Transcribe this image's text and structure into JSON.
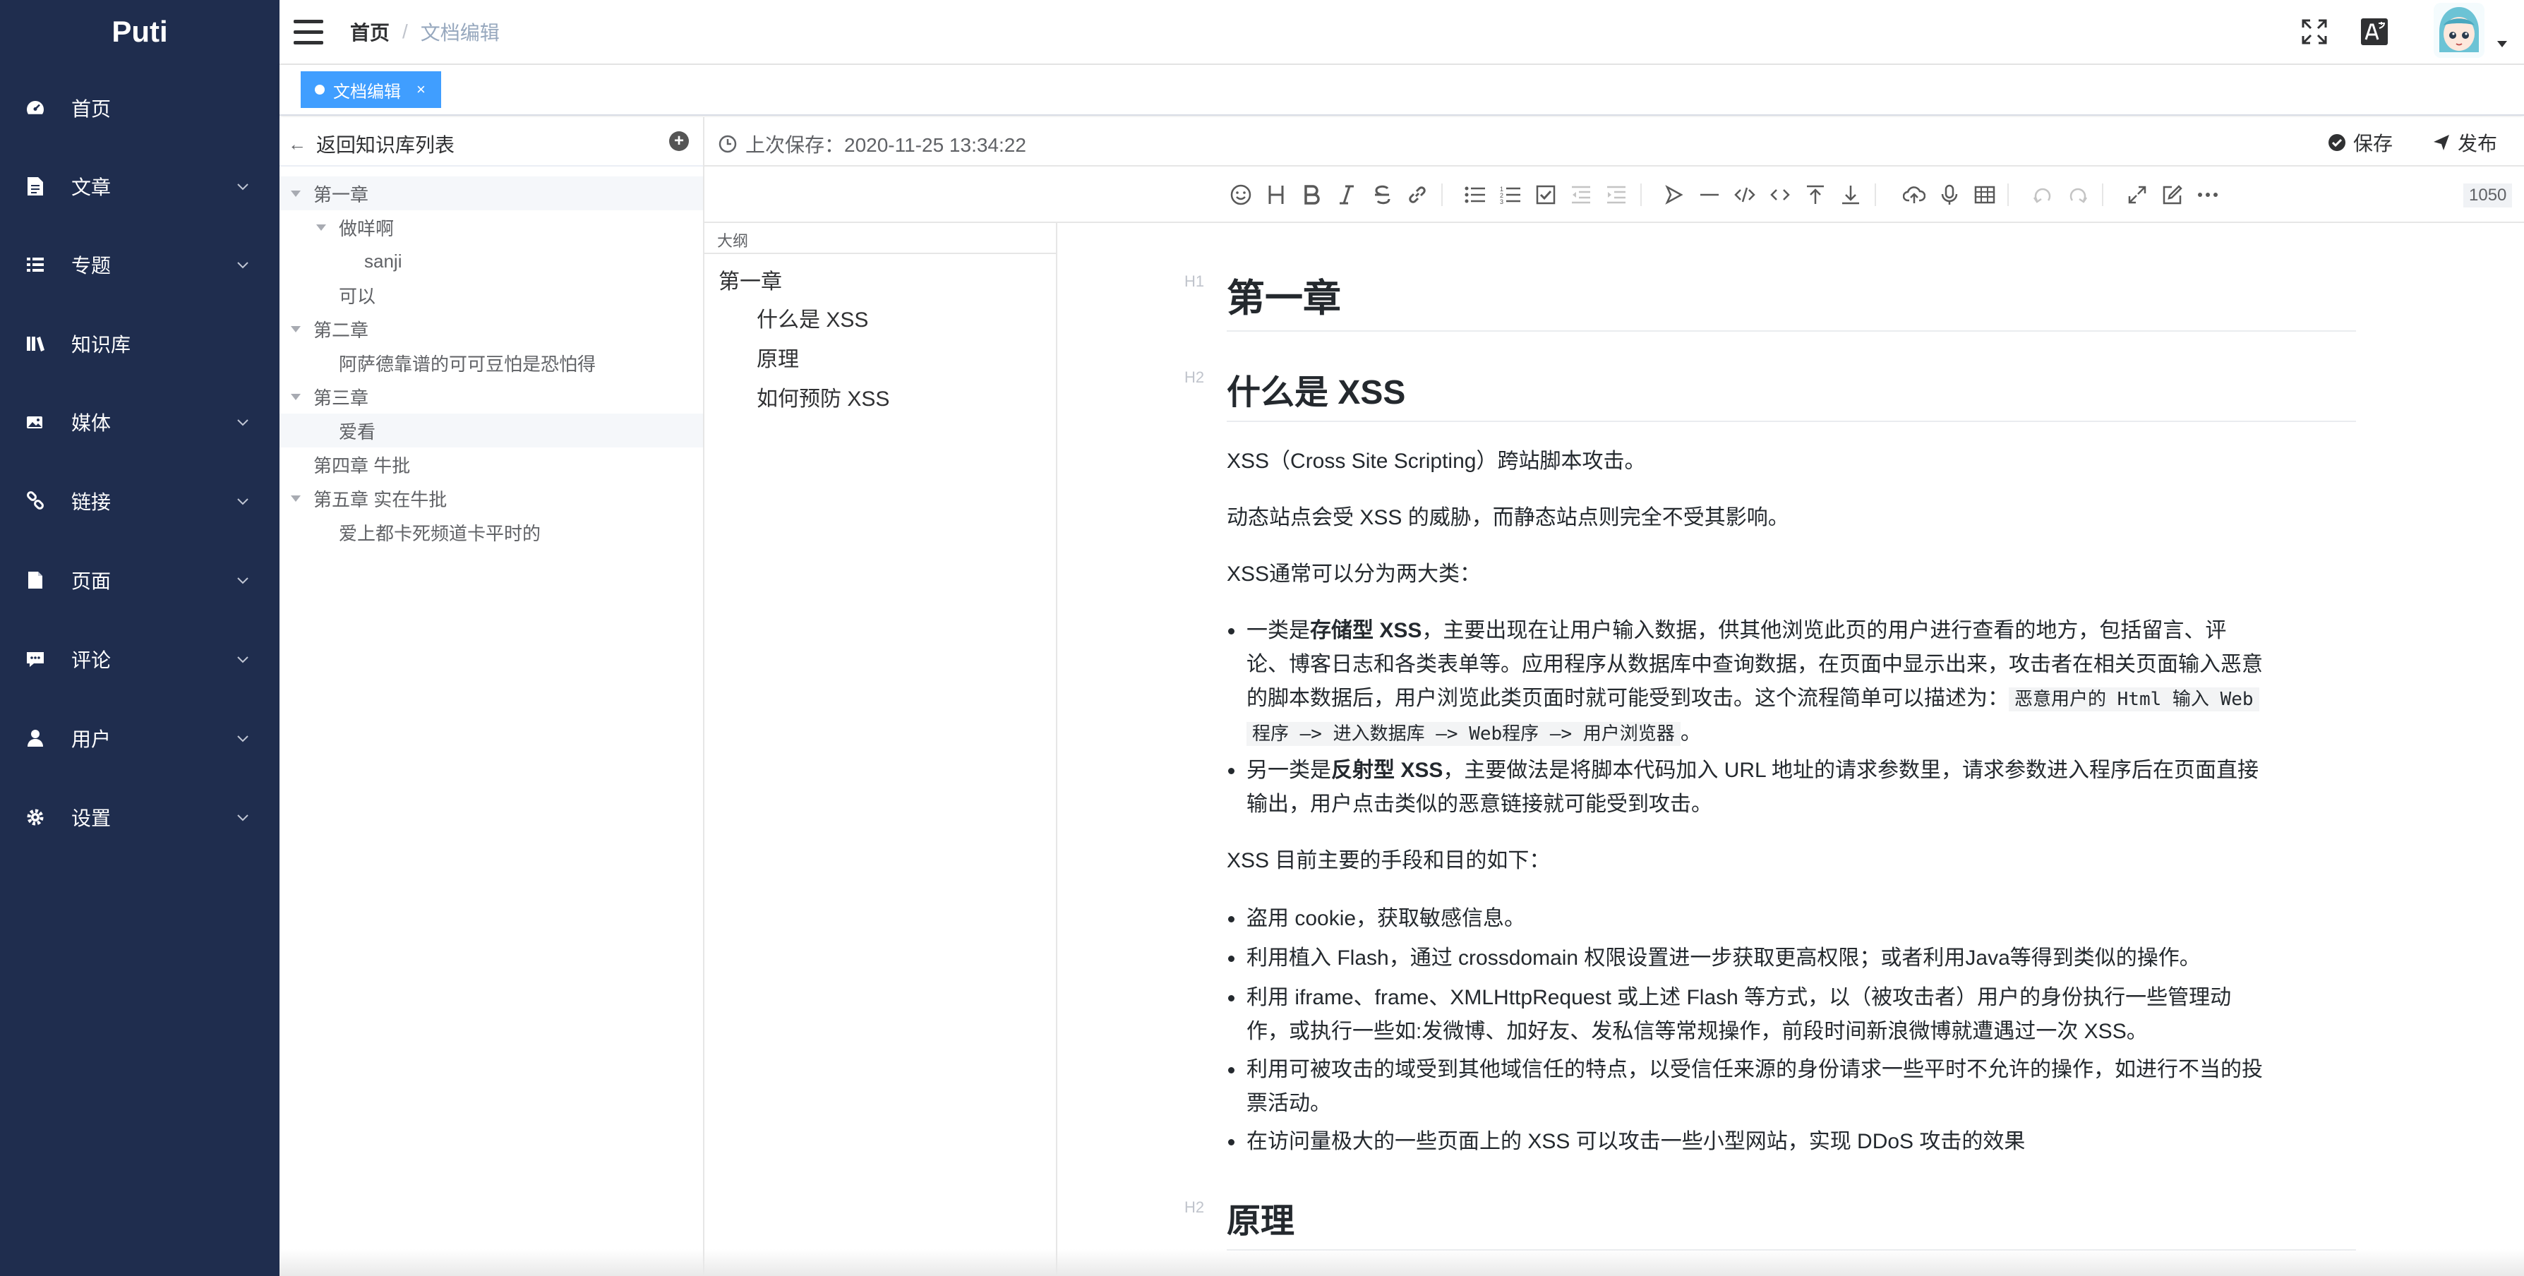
{
  "app": {
    "brand": "Puti"
  },
  "sidebar": {
    "items": [
      {
        "label": "首页",
        "icon": "dashboard-icon",
        "has_submenu": false
      },
      {
        "label": "文章",
        "icon": "document-icon",
        "has_submenu": true
      },
      {
        "label": "专题",
        "icon": "list-icon",
        "has_submenu": true
      },
      {
        "label": "知识库",
        "icon": "library-icon",
        "has_submenu": false
      },
      {
        "label": "媒体",
        "icon": "image-icon",
        "has_submenu": true
      },
      {
        "label": "链接",
        "icon": "link-icon",
        "has_submenu": true
      },
      {
        "label": "页面",
        "icon": "page-icon",
        "has_submenu": true
      },
      {
        "label": "评论",
        "icon": "comment-icon",
        "has_submenu": true
      },
      {
        "label": "用户",
        "icon": "user-icon",
        "has_submenu": true
      },
      {
        "label": "设置",
        "icon": "gear-icon",
        "has_submenu": true
      }
    ]
  },
  "header": {
    "breadcrumb": {
      "home": "首页",
      "separator": "/",
      "current": "文档编辑"
    }
  },
  "tags": {
    "active": "文档编辑",
    "close": "×"
  },
  "tree": {
    "back_label": "返回知识库列表",
    "add": "+",
    "nodes": [
      {
        "label": "第一章",
        "level": 0,
        "expanded": true
      },
      {
        "label": "做咩啊",
        "level": 1,
        "expanded": true
      },
      {
        "label": "sanji",
        "level": 2
      },
      {
        "label": "可以",
        "level": 1
      },
      {
        "label": "第二章",
        "level": 0,
        "expanded": true
      },
      {
        "label": "阿萨德靠谱的可可豆怕是恐怕得",
        "level": 1
      },
      {
        "label": "第三章",
        "level": 0,
        "expanded": true
      },
      {
        "label": "爱看",
        "level": 1
      },
      {
        "label": "第四章 牛批",
        "level": 0
      },
      {
        "label": "第五章 实在牛批",
        "level": 0,
        "expanded": true
      },
      {
        "label": "爱上都卡死频道卡平时的",
        "level": 1
      }
    ]
  },
  "editor": {
    "last_saved": "上次保存：2020-11-25 13:34:22",
    "save_label": "保存",
    "publish_label": "发布",
    "char_count": "1050",
    "toolbar_icons": [
      "emoji-icon",
      "heading-icon",
      "bold-icon",
      "italic-icon",
      "strike-icon",
      "link-icon",
      "unordered-list-icon",
      "ordered-list-icon",
      "checklist-icon",
      "outdent-icon",
      "indent-icon",
      "quote-icon",
      "line-icon",
      "code-icon",
      "inline-code-icon",
      "insert-before-icon",
      "insert-after-icon",
      "upload-icon",
      "record-icon",
      "table-icon",
      "undo-icon",
      "redo-icon",
      "fullscreen-icon",
      "edit-mode-icon",
      "more-icon"
    ]
  },
  "outline": {
    "title": "大纲",
    "items": [
      {
        "label": "第一章",
        "level": 1
      },
      {
        "label": "什么是 XSS",
        "level": 2
      },
      {
        "label": "原理",
        "level": 2
      },
      {
        "label": "如何预防 XSS",
        "level": 2
      }
    ]
  },
  "preview": {
    "h_tags": {
      "h1": "H1",
      "h2": "H2"
    },
    "h1": "第一章",
    "h2_1": "什么是 XSS",
    "p1": "XSS（Cross Site Scripting）跨站脚本攻击。",
    "p2": "动态站点会受 XSS 的威胁，而静态站点则完全不受其影响。",
    "p3": "XSS通常可以分为两大类：",
    "list1": {
      "item1_pre": "一类是",
      "item1_bold": "存储型 XSS",
      "item1_line1": "，主要出现在让用户输入数据，供其他浏览此页的用户进行查看的地方，包括留言、评",
      "item1_line2": "论、博客日志和各类表单等。应用程序从数据库中查询数据，在页面中显示出来，攻击者在相关页面输入恶意",
      "item1_line3": "的脚本数据后，用户浏览此类页面时就可能受到攻击。这个流程简单可以描述为：",
      "item1_code1": "恶意用户的 Html 输入 Web",
      "item1_code2": "程序 —> 进入数据库 —> Web程序 —> 用户浏览器",
      "item1_end": "。",
      "item2_pre": "另一类是",
      "item2_bold": "反射型 XSS",
      "item2_line1": "，主要做法是将脚本代码加入 URL 地址的请求参数里，请求参数进入程序后在页面直接",
      "item2_line2": "输出，用户点击类似的恶意链接就可能受到攻击。"
    },
    "p4": "XSS 目前主要的手段和目的如下：",
    "list2": [
      {
        "lines": [
          "盗用 cookie，获取敏感信息。"
        ]
      },
      {
        "lines": [
          "利用植入 Flash，通过 crossdomain 权限设置进一步获取更高权限；或者利用Java等得到类似的操作。"
        ]
      },
      {
        "lines": [
          "利用 iframe、frame、XMLHttpRequest 或上述 Flash 等方式，以（被攻击者）用户的身份执行一些管理动",
          "作，或执行一些如:发微博、加好友、发私信等常规操作，前段时间新浪微博就遭遇过一次 XSS。"
        ]
      },
      {
        "lines": [
          "利用可被攻击的域受到其他域信任的特点，以受信任来源的身份请求一些平时不允许的操作，如进行不当的投",
          "票活动。"
        ]
      },
      {
        "lines": [
          "在访问量极大的一些页面上的 XSS 可以攻击一些小型网站，实现 DDoS 攻击的效果"
        ]
      }
    ],
    "h2_2": "原理"
  },
  "colors": {
    "sidebar_bg": "#1f2d4e",
    "accent": "#409eff",
    "text": "#303133"
  }
}
